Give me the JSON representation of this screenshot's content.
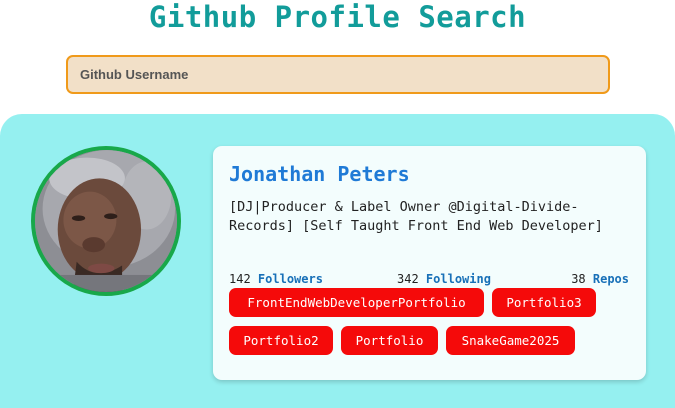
{
  "header": {
    "title": "Github Profile Search"
  },
  "search": {
    "placeholder": "Github Username",
    "value": ""
  },
  "profile": {
    "name": "Jonathan Peters",
    "bio": "[DJ|Producer & Label Owner @Digital-Divide-Records] [Self Taught Front End Web Developer]",
    "stats": {
      "followers": {
        "count": "142",
        "label": "Followers"
      },
      "following": {
        "count": "342",
        "label": "Following"
      },
      "repos": {
        "count": "38",
        "label": "Repos"
      }
    },
    "repo_links": [
      "FrontEndWebDeveloperPortfolio",
      "Portfolio3",
      "Portfolio2",
      "Portfolio",
      "SnakeGame2025"
    ]
  },
  "colors": {
    "title": "#129c9a",
    "panel": "#95f0f0",
    "name": "#1f7ad6",
    "repo_button": "#f50a0a",
    "avatar_ring": "#18a84a",
    "search_border": "#f09a1a",
    "search_bg": "#f2e0c8"
  }
}
